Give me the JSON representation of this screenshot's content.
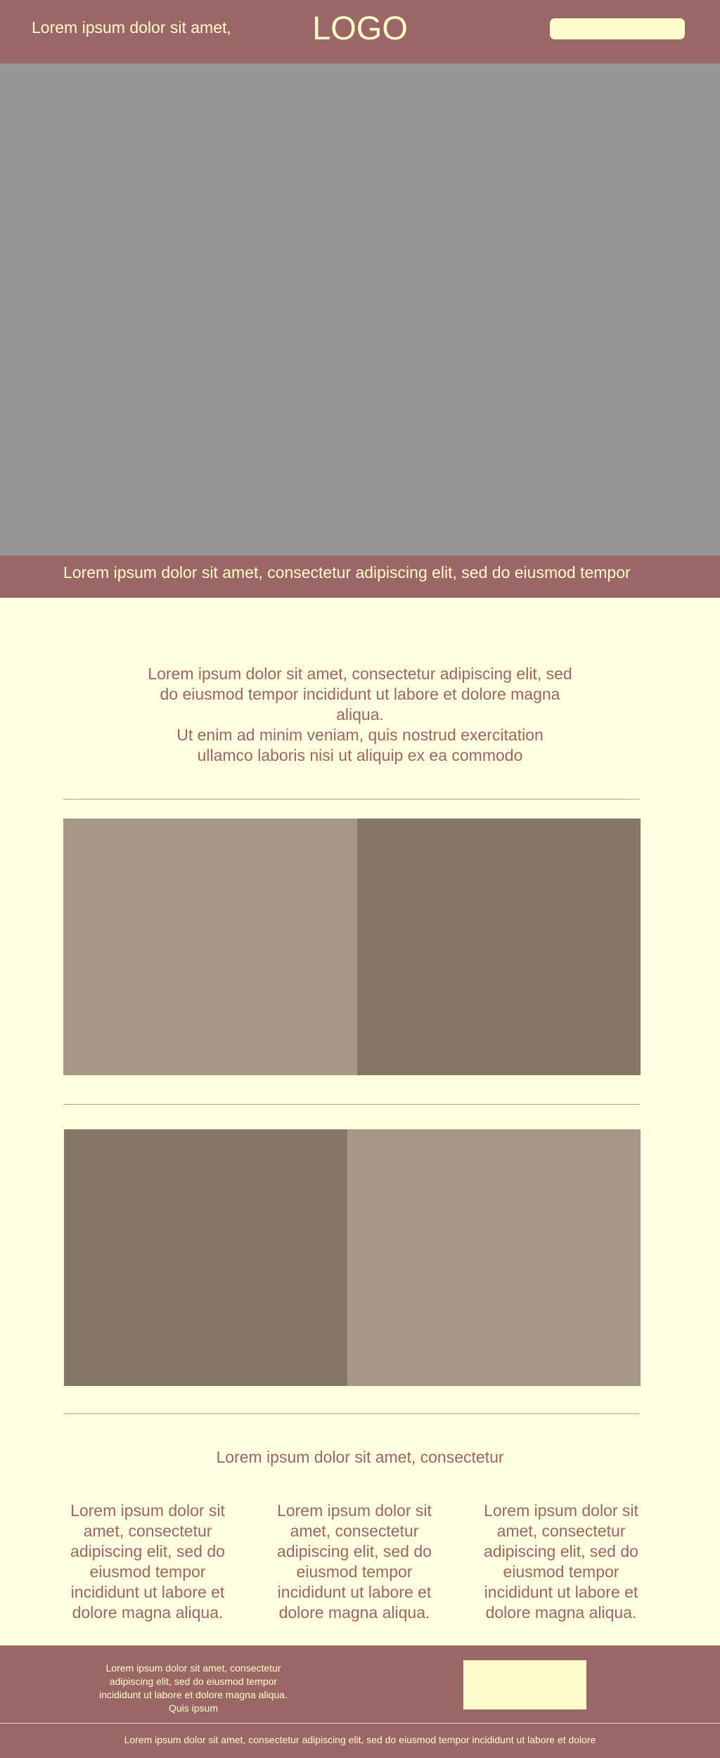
{
  "header": {
    "tagline": "Lorem ipsum dolor sit amet,",
    "logo": "LOGO"
  },
  "banner": {
    "text": "Lorem ipsum dolor sit amet, consectetur adipiscing elit, sed do eiusmod tempor"
  },
  "intro": {
    "lines": [
      "Lorem ipsum dolor sit amet, consectetur adipiscing elit, sed",
      "do eiusmod tempor incididunt ut labore et dolore magna",
      "aliqua.",
      "Ut enim ad minim veniam, quis nostrud exercitation",
      "ullamco laboris nisi ut aliquip ex ea commodo"
    ]
  },
  "features": {
    "title": "Lorem ipsum dolor sit amet, consectetur",
    "columns": [
      {
        "text": "Lorem ipsum dolor sit amet, consectetur adipiscing elit, sed do eiusmod tempor incididunt ut labore et dolore magna aliqua."
      },
      {
        "text": "Lorem ipsum dolor sit amet, consectetur adipiscing elit, sed do eiusmod tempor incididunt ut labore et dolore magna aliqua."
      },
      {
        "text": "Lorem ipsum dolor sit amet, consectetur adipiscing elit, sed do eiusmod tempor incididunt ut labore et dolore magna aliqua."
      }
    ]
  },
  "footer": {
    "text": "Lorem ipsum dolor sit amet, consectetur adipiscing elit, sed do eiusmod tempor incididunt ut labore et dolore magna aliqua. Quis ipsum",
    "copyright": "Lorem ipsum dolor sit amet, consectetur adipiscing elit, sed do eiusmod tempor incididunt ut labore et dolore"
  },
  "colors": {
    "primary": "#9a6666",
    "cream": "#fffcc9",
    "background": "#fffee0",
    "placeholder_gray": "#959595",
    "tan_light": "#a69786",
    "tan_dark": "#857666"
  }
}
